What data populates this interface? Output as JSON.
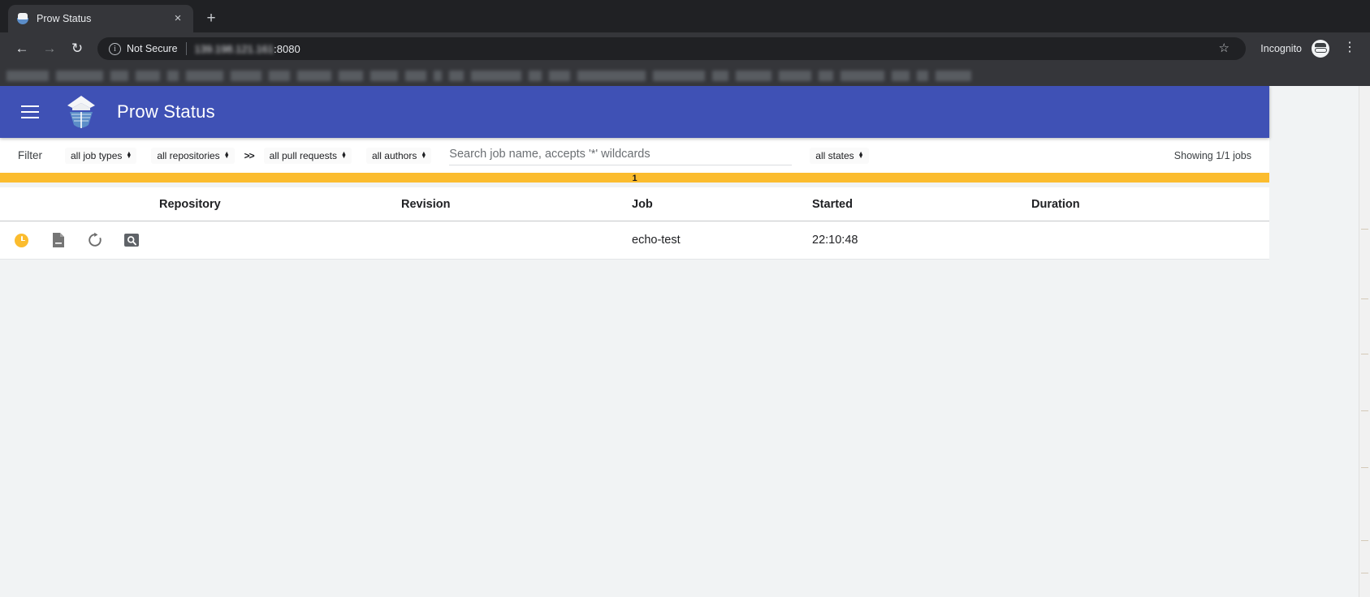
{
  "browser": {
    "tab": {
      "title": "Prow Status",
      "favicon": "prow-ship-icon",
      "close_label": "×"
    },
    "new_tab_label": "+",
    "nav": {
      "back": "←",
      "forward": "→",
      "reload": "↻"
    },
    "omnibox": {
      "info_glyph": "i",
      "security_text": "Not Secure",
      "url_host": "139.198.121.161",
      "url_port": ":8080",
      "star_glyph": "☆"
    },
    "profile": {
      "incognito_label": "Incognito",
      "menu_glyph": "⋮"
    }
  },
  "appbar": {
    "menu_icon": "hamburger-menu-icon",
    "logo_icon": "prow-logo-icon",
    "title": "Prow Status"
  },
  "filter": {
    "label": "Filter",
    "job_types": "all job types",
    "repositories": "all repositories",
    "separator": ">>",
    "pull_requests": "all pull requests",
    "authors": "all authors",
    "search_placeholder": "Search job name, accepts '*' wildcards",
    "search_value": "",
    "states": "all states",
    "showing": "Showing 1/1 jobs"
  },
  "progress": {
    "count_label": "1",
    "color": "#fbbc2e"
  },
  "table": {
    "columns": [
      "",
      "Repository",
      "Revision",
      "Job",
      "Started",
      "Duration"
    ],
    "rows": [
      {
        "state": "pending",
        "state_icon": "clock-icon",
        "artifacts_icon": "file-document-icon",
        "rerun_icon": "refresh-icon",
        "inspect_icon": "magnifier-box-icon",
        "repository": "",
        "revision": "",
        "job": "echo-test",
        "started": "22:10:48",
        "duration": ""
      }
    ]
  },
  "colors": {
    "appbar": "#3f51b5",
    "accent_yellow": "#fbbc2e",
    "page_bg": "#f1f3f4"
  }
}
